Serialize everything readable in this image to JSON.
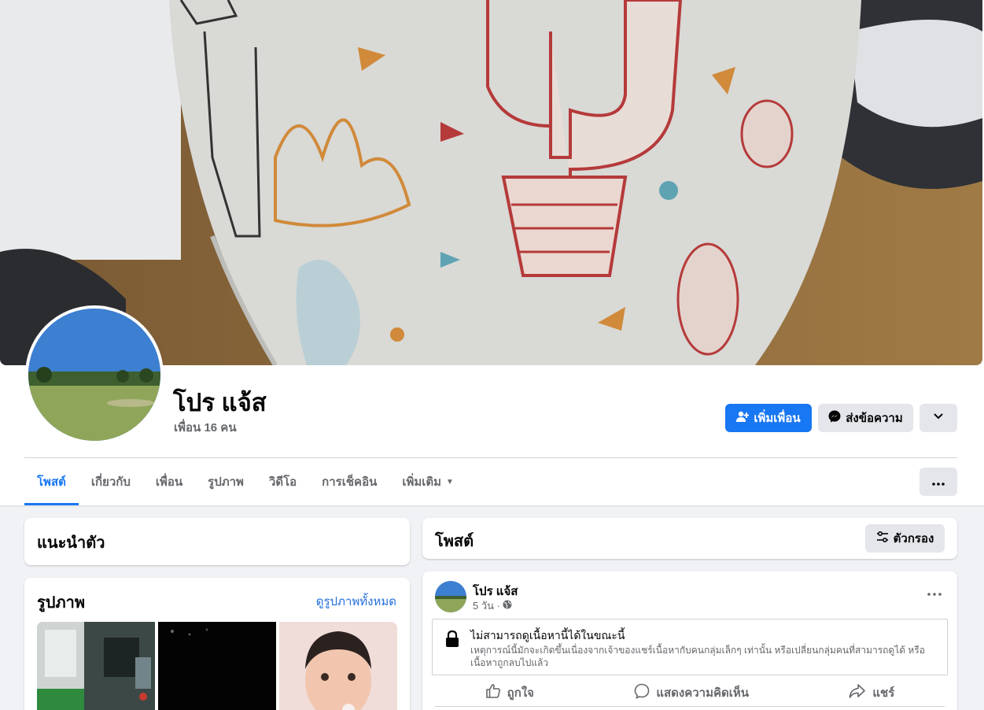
{
  "profile": {
    "name": "โปร แจ้ส",
    "friend_count": "เพื่อน 16 คน"
  },
  "actions": {
    "add_friend": "เพิ่มเพื่อน",
    "message": "ส่งข้อความ"
  },
  "tabs": [
    {
      "label": "โพสต์",
      "active": true
    },
    {
      "label": "เกี่ยวกับ",
      "active": false
    },
    {
      "label": "เพื่อน",
      "active": false
    },
    {
      "label": "รูปภาพ",
      "active": false
    },
    {
      "label": "วิดีโอ",
      "active": false
    },
    {
      "label": "การเช็คอิน",
      "active": false
    },
    {
      "label": "เพิ่มเติม",
      "active": false
    }
  ],
  "intro": {
    "title": "แนะนำตัว"
  },
  "photos": {
    "title": "รูปภาพ",
    "see_all": "ดูรูปภาพทั้งหมด"
  },
  "posts": {
    "title": "โพสต์",
    "filter_label": "ตัวกรอง"
  },
  "post": {
    "author": "โปร แจ้ส",
    "time": "5 วัน ·",
    "unavailable_title": "ไม่สามารถดูเนื้อหานี้ได้ในขณะนี้",
    "unavailable_desc": "เหตุการณ์นี้มักจะเกิดขึ้นเนื่องจากเจ้าของแชร์เนื้อหากับคนกลุ่มเล็กๆ เท่านั้น หรือเปลี่ยนกลุ่มคนที่สามารถดูได้ หรือเนื้อหาถูกลบไปแล้ว",
    "like": "ถูกใจ",
    "comment": "แสดงความคิดเห็น",
    "share": "แชร์"
  },
  "colors": {
    "accent": "#1877f2",
    "button_gray": "#e4e6eb",
    "page_bg": "#f0f2f5"
  },
  "icons": [
    "add-friend-icon",
    "messenger-icon",
    "chevron-down-icon",
    "more-icon",
    "filter-icon",
    "globe-icon",
    "lock-icon",
    "like-icon",
    "comment-icon",
    "share-icon"
  ]
}
